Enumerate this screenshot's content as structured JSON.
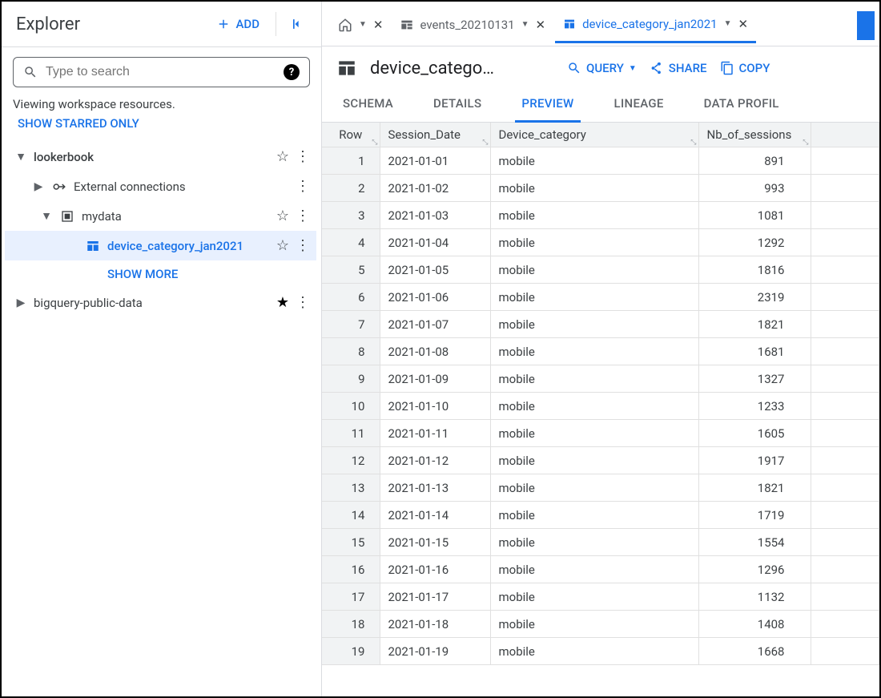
{
  "sidebar": {
    "title": "Explorer",
    "add_label": "ADD",
    "search_placeholder": "Type to search",
    "viewing_text": "Viewing workspace resources.",
    "starred_link": "SHOW STARRED ONLY",
    "tree": {
      "project1": "lookerbook",
      "project1_ext": "External connections",
      "dataset1": "mydata",
      "table1": "device_category_jan2021",
      "show_more": "SHOW MORE",
      "project2": "bigquery-public-data"
    }
  },
  "tabs": {
    "events_tab": "events_20210131",
    "device_tab": "device_category_jan2021"
  },
  "page": {
    "title": "device_catego…",
    "query_label": "QUERY",
    "share_label": "SHARE",
    "copy_label": "COPY",
    "subtabs": {
      "schema": "SCHEMA",
      "details": "DETAILS",
      "preview": "PREVIEW",
      "lineage": "LINEAGE",
      "data_profile": "DATA PROFIL"
    }
  },
  "table": {
    "headers": {
      "row": "Row",
      "session_date": "Session_Date",
      "device_category": "Device_category",
      "nb_sessions": "Nb_of_sessions"
    },
    "rows": [
      {
        "n": "1",
        "date": "2021-01-01",
        "cat": "mobile",
        "sess": "891"
      },
      {
        "n": "2",
        "date": "2021-01-02",
        "cat": "mobile",
        "sess": "993"
      },
      {
        "n": "3",
        "date": "2021-01-03",
        "cat": "mobile",
        "sess": "1081"
      },
      {
        "n": "4",
        "date": "2021-01-04",
        "cat": "mobile",
        "sess": "1292"
      },
      {
        "n": "5",
        "date": "2021-01-05",
        "cat": "mobile",
        "sess": "1816"
      },
      {
        "n": "6",
        "date": "2021-01-06",
        "cat": "mobile",
        "sess": "2319"
      },
      {
        "n": "7",
        "date": "2021-01-07",
        "cat": "mobile",
        "sess": "1821"
      },
      {
        "n": "8",
        "date": "2021-01-08",
        "cat": "mobile",
        "sess": "1681"
      },
      {
        "n": "9",
        "date": "2021-01-09",
        "cat": "mobile",
        "sess": "1327"
      },
      {
        "n": "10",
        "date": "2021-01-10",
        "cat": "mobile",
        "sess": "1233"
      },
      {
        "n": "11",
        "date": "2021-01-11",
        "cat": "mobile",
        "sess": "1605"
      },
      {
        "n": "12",
        "date": "2021-01-12",
        "cat": "mobile",
        "sess": "1917"
      },
      {
        "n": "13",
        "date": "2021-01-13",
        "cat": "mobile",
        "sess": "1821"
      },
      {
        "n": "14",
        "date": "2021-01-14",
        "cat": "mobile",
        "sess": "1719"
      },
      {
        "n": "15",
        "date": "2021-01-15",
        "cat": "mobile",
        "sess": "1554"
      },
      {
        "n": "16",
        "date": "2021-01-16",
        "cat": "mobile",
        "sess": "1296"
      },
      {
        "n": "17",
        "date": "2021-01-17",
        "cat": "mobile",
        "sess": "1132"
      },
      {
        "n": "18",
        "date": "2021-01-18",
        "cat": "mobile",
        "sess": "1408"
      },
      {
        "n": "19",
        "date": "2021-01-19",
        "cat": "mobile",
        "sess": "1668"
      }
    ]
  }
}
